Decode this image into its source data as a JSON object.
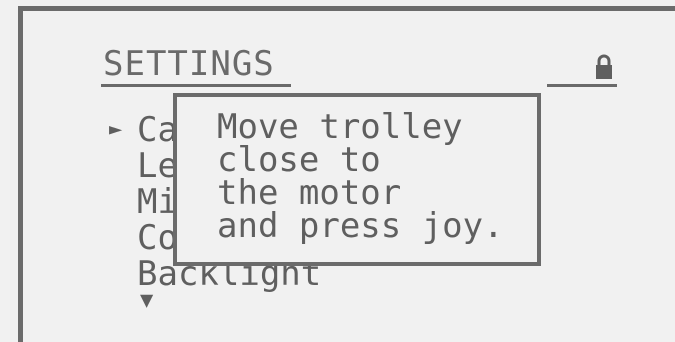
{
  "screen": {
    "title": "SETTINGS",
    "lock_icon": "lock-icon",
    "cursor": "►",
    "scroll_down": "▼",
    "menu_items": [
      "Ca",
      "Le",
      "Mi",
      "Co",
      "Backlight"
    ]
  },
  "dialog": {
    "lines": [
      "Move trolley",
      "close to",
      "the motor",
      "and press joy."
    ]
  },
  "colors": {
    "background": "#f1f1f1",
    "foreground": "#5f5f5f",
    "frame": "#6b6b6b"
  }
}
